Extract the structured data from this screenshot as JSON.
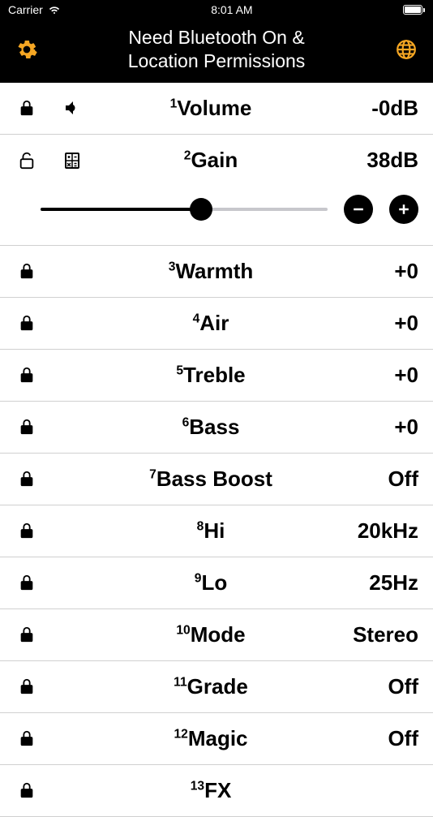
{
  "status": {
    "carrier": "Carrier",
    "time": "8:01 AM"
  },
  "header": {
    "title_line1": "Need Bluetooth On &",
    "title_line2": "Location Permissions"
  },
  "rows": {
    "volume": {
      "sup": "1",
      "label": "Volume",
      "value": "-0dB"
    },
    "gain": {
      "sup": "2",
      "label": "Gain",
      "value": "38dB"
    },
    "warmth": {
      "sup": "3",
      "label": "Warmth",
      "value": "+0"
    },
    "air": {
      "sup": "4",
      "label": "Air",
      "value": "+0"
    },
    "treble": {
      "sup": "5",
      "label": "Treble",
      "value": "+0"
    },
    "bass": {
      "sup": "6",
      "label": "Bass",
      "value": "+0"
    },
    "bassboost": {
      "sup": "7",
      "label": "Bass Boost",
      "value": "Off"
    },
    "hi": {
      "sup": "8",
      "label": "Hi",
      "value": "20kHz"
    },
    "lo": {
      "sup": "9",
      "label": "Lo",
      "value": "25Hz"
    },
    "mode": {
      "sup": "10",
      "label": "Mode",
      "value": "Stereo"
    },
    "grade": {
      "sup": "11",
      "label": "Grade",
      "value": "Off"
    },
    "magic": {
      "sup": "12",
      "label": "Magic",
      "value": "Off"
    },
    "fx": {
      "sup": "13",
      "label": "FX",
      "value": ""
    }
  }
}
